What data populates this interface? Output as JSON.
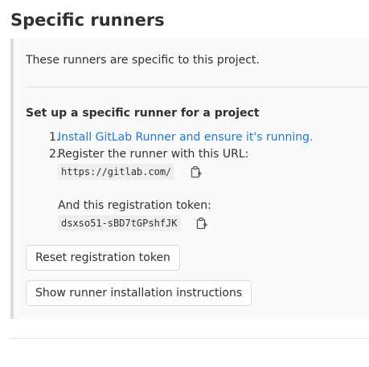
{
  "section": {
    "title": "Specific runners"
  },
  "panel": {
    "intro": "These runners are specific to this project.",
    "setup_title": "Set up a specific runner for a project",
    "steps": [
      {
        "number": "1.",
        "link_text": "Install GitLab Runner and ensure it's running."
      },
      {
        "number": "2.",
        "text": "Register the runner with this URL:"
      }
    ],
    "url": "https://gitlab.com/",
    "token_label": "And this registration token:",
    "token": "dsxso51-sBD7tGPshfJK",
    "copy_icon": "clipboard-icon"
  },
  "buttons": {
    "reset_token": "Reset registration token",
    "show_instructions": "Show runner installation instructions"
  },
  "colors": {
    "link": "#1f78d1",
    "panel_bg": "#fafafa",
    "panel_border": "#dbdbdb"
  }
}
